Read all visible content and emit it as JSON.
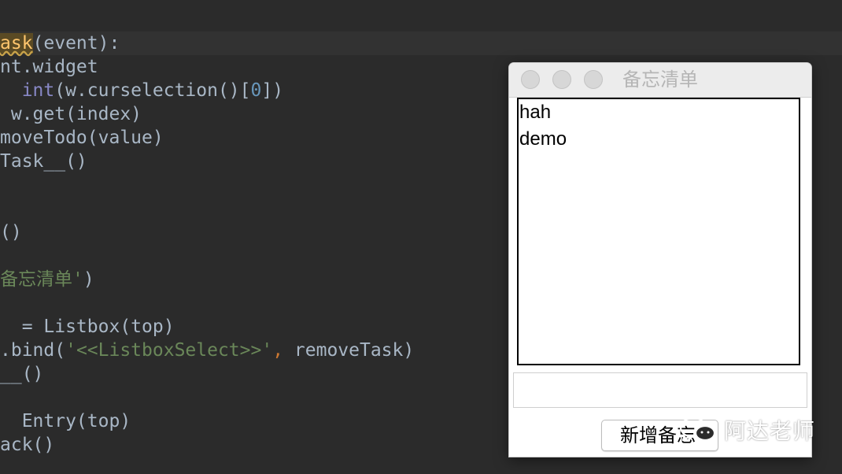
{
  "editor": {
    "lines": [
      {
        "segments": [
          {
            "text": "ask",
            "cls": "fn-hl"
          },
          {
            "text": "(event):",
            "cls": ""
          }
        ]
      },
      {
        "segments": [
          {
            "text": "nt.widget",
            "cls": ""
          }
        ]
      },
      {
        "segments": [
          {
            "text": "  ",
            "cls": ""
          },
          {
            "text": "int",
            "cls": "builtin"
          },
          {
            "text": "(w.curselection()[",
            "cls": ""
          },
          {
            "text": "0",
            "cls": "num"
          },
          {
            "text": "])",
            "cls": ""
          }
        ]
      },
      {
        "segments": [
          {
            "text": " w.get(index)",
            "cls": ""
          }
        ]
      },
      {
        "segments": [
          {
            "text": "moveTodo(value)",
            "cls": ""
          }
        ]
      },
      {
        "segments": [
          {
            "text": "Task__()",
            "cls": ""
          }
        ]
      },
      {
        "segments": [
          {
            "text": "()",
            "cls": ""
          }
        ]
      },
      {
        "segments": [
          {
            "text": "备忘清单'",
            "cls": "str"
          },
          {
            "text": ")",
            "cls": ""
          }
        ]
      },
      {
        "segments": [
          {
            "text": "  = Listbox(top)",
            "cls": ""
          }
        ]
      },
      {
        "segments": [
          {
            "text": ".bind(",
            "cls": ""
          },
          {
            "text": "'<<ListboxSelect>>'",
            "cls": "str"
          },
          {
            "text": ", ",
            "cls": "punct"
          },
          {
            "text": "removeTask)",
            "cls": ""
          }
        ]
      },
      {
        "segments": [
          {
            "text": "__()",
            "cls": ""
          }
        ]
      },
      {
        "segments": [
          {
            "text": "  Entry(top)",
            "cls": ""
          }
        ]
      },
      {
        "segments": [
          {
            "text": "ack()",
            "cls": ""
          }
        ]
      }
    ]
  },
  "window": {
    "title": "备忘清单",
    "listbox_items": [
      "hah",
      "demo"
    ],
    "entry_value": "",
    "add_button_label": "新增备忘"
  },
  "watermark": {
    "text": "阿达老师",
    "icon": "wechat-icon"
  },
  "colors": {
    "editor_bg": "#2b2b2b",
    "code_default": "#a9b7c6",
    "function_highlight": "#ffc66d",
    "builtin": "#8888c6",
    "number": "#6897bb",
    "string": "#6a8759",
    "punctuation": "#cc7832"
  }
}
